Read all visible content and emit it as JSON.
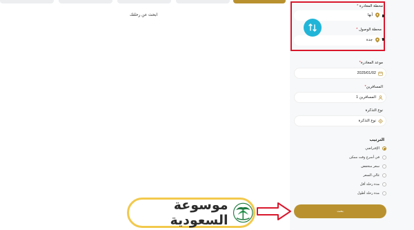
{
  "top_bar": {
    "search_trip_link": "ابحث عن رحلتك"
  },
  "stations": {
    "departure_label": "محطة المغادرة",
    "departure_value": "أبها",
    "arrival_label": "محطة الوصول",
    "arrival_value": "جدة",
    "required_mark": "*"
  },
  "departure_date": {
    "label": "موعد المغادرة",
    "required_mark": "*",
    "value": "2025/01/02"
  },
  "passengers": {
    "label": "المسافرين",
    "required_mark": "*",
    "value": "1 المسافرين"
  },
  "ticket_type": {
    "label": "نوع التذكرة",
    "value": "نوع التذكرة"
  },
  "sort": {
    "title": "الترتيب",
    "options": [
      {
        "label": "الإفتراضي",
        "selected": true
      },
      {
        "label": "في أسرع وقت ممكن",
        "selected": false
      },
      {
        "label": "سعر منخفض",
        "selected": false
      },
      {
        "label": "غالي السعر",
        "selected": false
      },
      {
        "label": "مدة رحلة أقل",
        "selected": false
      },
      {
        "label": "مدة رحلة أطول",
        "selected": false
      }
    ]
  },
  "search_button": "بحث",
  "watermark": {
    "text": "موسوعة السعودية"
  },
  "colors": {
    "accent": "#b9912f",
    "swap": "#20b5d8",
    "highlight": "#d9162b"
  }
}
